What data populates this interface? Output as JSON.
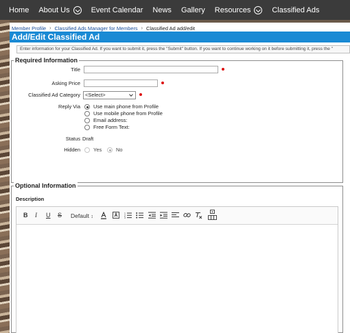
{
  "nav": {
    "items": [
      {
        "label": "Home",
        "dropdown": false
      },
      {
        "label": "About Us",
        "dropdown": true
      },
      {
        "label": "Event Calendar",
        "dropdown": false
      },
      {
        "label": "News",
        "dropdown": false
      },
      {
        "label": "Gallery",
        "dropdown": false
      },
      {
        "label": "Resources",
        "dropdown": true
      },
      {
        "label": "Classified Ads",
        "dropdown": false
      }
    ]
  },
  "breadcrumb": {
    "items": [
      "Member Profile",
      "Classified Ads Manager for Members",
      "Classified Ad add/edit"
    ],
    "separator": "›"
  },
  "page_title": "Add/Edit Classified Ad",
  "intro_text": "Enter information for your Classified Ad. If you want to submit it, press the \"Submit\" button. If you want to continue working on it before submitting it, press the \"",
  "required": {
    "legend": "Required Information",
    "title_label": "Title",
    "title_value": "",
    "price_label": "Asking Price",
    "price_value": "",
    "category_label": "Classified Ad Category",
    "category_value": "<Select>",
    "reply_label": "Reply Via",
    "reply_options": [
      {
        "label": "Use main phone from Profile",
        "checked": true
      },
      {
        "label": "Use mobile phone from Profile",
        "checked": false
      },
      {
        "label": "Email address:",
        "checked": false
      },
      {
        "label": "Free Form Text:",
        "checked": false
      }
    ],
    "status_label": "Status",
    "status_value": "Draft",
    "hidden_label": "Hidden",
    "hidden_yes": "Yes",
    "hidden_no": "No",
    "hidden_selected": "No"
  },
  "optional": {
    "legend": "Optional Information",
    "description_label": "Description"
  },
  "toolbar": {
    "bold": "B",
    "italic": "I",
    "underline": "U",
    "strike": "S",
    "font_size": "Default",
    "tools": [
      "bold-icon",
      "italic-icon",
      "underline-icon",
      "strikethrough-icon",
      "font-size-select",
      "text-color-icon",
      "background-color-icon",
      "ordered-list-icon",
      "unordered-list-icon",
      "outdent-icon",
      "indent-icon",
      "align-icon",
      "link-icon",
      "clear-format-icon",
      "table-icon"
    ]
  },
  "colors": {
    "nav_bg": "#3b3b3b",
    "title_bar": "#1a8ad4",
    "link": "#1b4f9c",
    "required_dot": "#dd1111"
  }
}
